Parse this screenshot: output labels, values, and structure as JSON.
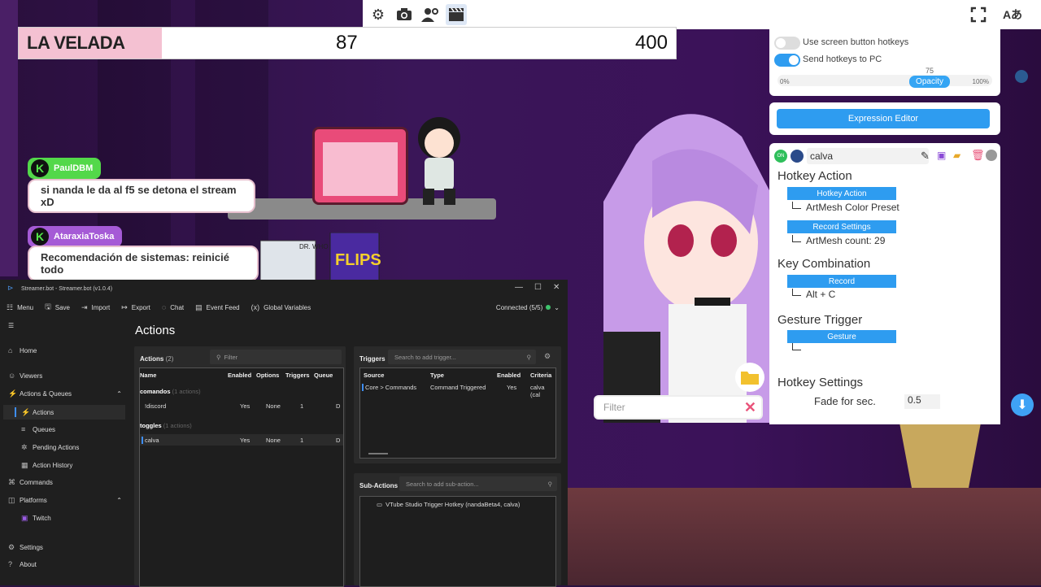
{
  "toolbar": {
    "icons": [
      "gear-icon",
      "camera-icon",
      "person-settings-icon",
      "clapperboard-icon"
    ],
    "right_icons": [
      "expand-icon",
      "translate-icon"
    ]
  },
  "velada": {
    "title": "LA VELADA",
    "value1": "87",
    "value2": "400"
  },
  "chat": [
    {
      "name": "PaulDBM",
      "message": "si nanda le da al f5 se detona el stream xD",
      "badge": "K",
      "color": "#53d84a"
    },
    {
      "name": "AtaraxiaToska",
      "message": "Recomendación de sistemas: reinicié todo",
      "badge": "K",
      "color": "#a55ad6"
    }
  ],
  "scene": {
    "box_label": "DR. WHO",
    "box2_label": "FLIPS"
  },
  "vts": {
    "toggle1_label": "Use screen button hotkeys",
    "toggle2_label": "Send hotkeys to PC",
    "opacity_value": "75",
    "opacity_label": "Opacity",
    "opacity_min": "0%",
    "opacity_max": "100%",
    "expression_editor": "Expression Editor",
    "hotkey_on": "ON",
    "hotkey_name": "calva",
    "hotkey_action_title": "Hotkey Action",
    "hotkey_action_btn": "Hotkey Action",
    "hotkey_action_value": "ArtMesh Color Preset",
    "record_settings_btn": "Record Settings",
    "record_settings_value": "ArtMesh count: 29",
    "key_combination_title": "Key Combination",
    "record_btn": "Record",
    "key_value": "Alt + C",
    "gesture_title": "Gesture Trigger",
    "gesture_btn": "Gesture",
    "hotkey_settings_title": "Hotkey Settings",
    "fade_label": "Fade for sec.",
    "fade_value": "0.5",
    "filter_placeholder": "Filter"
  },
  "streamerbot": {
    "title": "Streamer.bot - Streamer.bot (v1.0.4)",
    "menu": [
      {
        "icon": "menu-icon",
        "label": "Menu"
      },
      {
        "icon": "save-icon",
        "label": "Save"
      },
      {
        "icon": "import-icon",
        "label": "Import"
      },
      {
        "icon": "export-icon",
        "label": "Export"
      },
      {
        "icon": "chat-icon",
        "label": "Chat"
      },
      {
        "icon": "event-feed-icon",
        "label": "Event Feed"
      },
      {
        "icon": "variables-icon",
        "label": "Global Variables"
      }
    ],
    "connected": "Connected (5/5)",
    "sidebar": {
      "home": "Home",
      "viewers": "Viewers",
      "actions_queues": "Actions & Queues",
      "actions": "Actions",
      "queues": "Queues",
      "pending": "Pending Actions",
      "history": "Action History",
      "commands": "Commands",
      "platforms": "Platforms",
      "twitch": "Twitch",
      "settings": "Settings",
      "about": "About"
    },
    "page_title": "Actions",
    "actions_panel": {
      "label": "Actions",
      "count": "(2)",
      "filter_placeholder": "Filter",
      "columns": [
        "Name",
        "Enabled",
        "Options",
        "Triggers",
        "Queue"
      ],
      "group1": "comandos",
      "group1_count": "(1 actions)",
      "group2": "toggles",
      "group2_count": "(1 actions)",
      "rows": [
        {
          "name": "!discord",
          "enabled": "Yes",
          "options": "None",
          "triggers": "1",
          "queue": "D"
        },
        {
          "name": "calva",
          "enabled": "Yes",
          "options": "None",
          "triggers": "1",
          "queue": "D"
        }
      ]
    },
    "triggers_panel": {
      "label": "Triggers",
      "search_placeholder": "Search to add trigger...",
      "columns": [
        "Source",
        "Type",
        "Enabled",
        "Criteria"
      ],
      "rows": [
        {
          "source": "Core > Commands",
          "type": "Command Triggered",
          "enabled": "Yes",
          "criteria": "calva (cal"
        }
      ]
    },
    "subactions_panel": {
      "label": "Sub-Actions",
      "search_placeholder": "Search to add sub-action...",
      "item": "VTube Studio Trigger Hotkey (nandaBeta4, calva)"
    }
  }
}
